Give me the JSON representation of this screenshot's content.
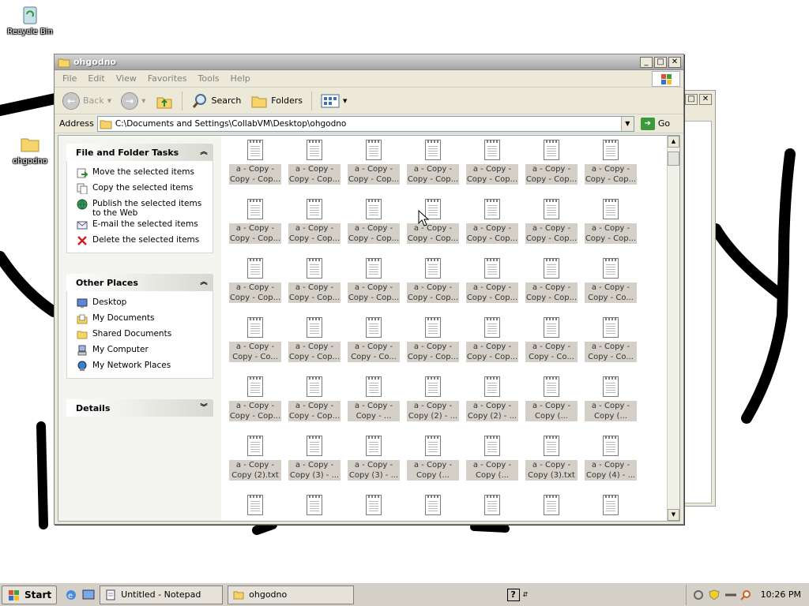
{
  "desktop": {
    "icons": [
      {
        "label": "Recycle Bin",
        "icon": "recycle-bin-icon"
      },
      {
        "label": "ohgodno",
        "icon": "folder-icon"
      }
    ]
  },
  "window": {
    "title": "ohgodno",
    "menu": [
      "File",
      "Edit",
      "View",
      "Favorites",
      "Tools",
      "Help"
    ],
    "toolbar": {
      "back": "Back",
      "search": "Search",
      "folders": "Folders"
    },
    "address": {
      "label": "Address",
      "value": "C:\\Documents and Settings\\CollabVM\\Desktop\\ohgodno",
      "go": "Go"
    },
    "left_pane": {
      "file_tasks": {
        "title": "File and Folder Tasks",
        "items": [
          {
            "label": "Move the selected items",
            "icon": "move-icon"
          },
          {
            "label": "Copy the selected items",
            "icon": "copy-icon"
          },
          {
            "label": "Publish the selected items\nto the Web",
            "icon": "globe-icon"
          },
          {
            "label": "E-mail the selected items",
            "icon": "email-icon"
          },
          {
            "label": "Delete the selected items",
            "icon": "delete-icon"
          }
        ]
      },
      "other_places": {
        "title": "Other Places",
        "items": [
          {
            "label": "Desktop",
            "icon": "desktop-icon"
          },
          {
            "label": "My Documents",
            "icon": "my-documents-icon"
          },
          {
            "label": "Shared Documents",
            "icon": "folder-icon"
          },
          {
            "label": "My Computer",
            "icon": "computer-icon"
          },
          {
            "label": "My Network Places",
            "icon": "network-icon"
          }
        ]
      },
      "details": {
        "title": "Details"
      }
    },
    "files": [
      [
        "a - Copy -\nCopy - Cop...",
        "a - Copy -\nCopy - Cop...",
        "a - Copy -\nCopy - Cop...",
        "a - Copy -\nCopy - Cop...",
        "a - Copy -\nCopy - Cop...",
        "a - Copy -\nCopy - Cop...",
        "a - Copy -\nCopy - Cop..."
      ],
      [
        "a - Copy -\nCopy - Cop...",
        "a - Copy -\nCopy - Cop...",
        "a - Copy -\nCopy - Cop...",
        "a - Copy -\nCopy - Cop...",
        "a - Copy -\nCopy - Cop...",
        "a - Copy -\nCopy - Cop...",
        "a - Copy -\nCopy - Cop..."
      ],
      [
        "a - Copy -\nCopy - Cop...",
        "a - Copy -\nCopy - Cop...",
        "a - Copy -\nCopy - Cop...",
        "a - Copy -\nCopy - Cop...",
        "a - Copy -\nCopy - Cop...",
        "a - Copy -\nCopy - Cop...",
        "a - Copy -\nCopy - Co..."
      ],
      [
        "a - Copy -\nCopy - Co...",
        "a - Copy -\nCopy - Cop...",
        "a - Copy -\nCopy - Co...",
        "a - Copy -\nCopy - Cop...",
        "a - Copy -\nCopy - Cop...",
        "a - Copy -\nCopy - Co...",
        "a - Copy -\nCopy - Co..."
      ],
      [
        "a - Copy -\nCopy - Cop...",
        "a - Copy -\nCopy - Cop...",
        "a - Copy -\nCopy - ...",
        "a - Copy -\nCopy (2) - ...",
        "a - Copy -\nCopy (2) - ...",
        "a - Copy -\nCopy (...",
        "a - Copy -\nCopy (..."
      ],
      [
        "a - Copy -\nCopy (2).txt",
        "a - Copy -\nCopy (3) - ...",
        "a - Copy -\nCopy (3) - ...",
        "a - Copy -\nCopy (...",
        "a - Copy -\nCopy (...",
        "a - Copy -\nCopy (3).txt",
        "a - Copy -\nCopy (4) - ..."
      ],
      [
        "",
        "",
        "",
        "",
        "",
        "",
        ""
      ]
    ]
  },
  "taskbar": {
    "start": "Start",
    "tasks": [
      {
        "label": "Untitled - Notepad",
        "icon": "notepad-icon"
      },
      {
        "label": "ohgodno",
        "icon": "folder-icon"
      }
    ],
    "clock": "10:26 PM"
  }
}
